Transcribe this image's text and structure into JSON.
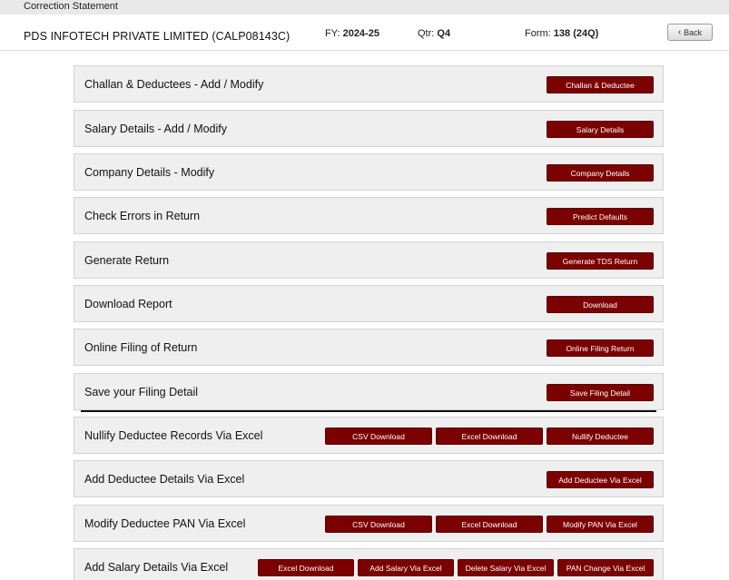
{
  "window": {
    "title": "Correction Statement"
  },
  "header": {
    "company": "PDS INFOTECH PRIVATE LIMITED (CALP08143C)",
    "fy_label": "FY:",
    "fy_value": "2024-25",
    "qtr_label": "Qtr:",
    "qtr_value": "Q4",
    "form_label": "Form:",
    "form_value": "138 (24Q)",
    "back_label": "Back"
  },
  "rows": [
    {
      "label": "Challan & Deductees - Add / Modify",
      "buttons": [
        "Challan & Deductee"
      ]
    },
    {
      "label": "Salary Details - Add / Modify",
      "buttons": [
        "Salary Details"
      ]
    },
    {
      "label": "Company Details - Modify",
      "buttons": [
        "Company Details"
      ]
    },
    {
      "label": "Check Errors in Return",
      "buttons": [
        "Predict Defaults"
      ]
    },
    {
      "label": "Generate Return",
      "buttons": [
        "Generate TDS Return"
      ]
    },
    {
      "label": "Download Report",
      "buttons": [
        "Download"
      ]
    },
    {
      "label": "Online Filing of Return",
      "buttons": [
        "Online Filing Return"
      ]
    },
    {
      "label": "Save your Filing Detail",
      "buttons": [
        "Save Filing Detail"
      ]
    },
    {
      "label": "Nullify Deductee Records Via Excel",
      "buttons": [
        "CSV Download",
        "Excel Download",
        "Nullify Deductee"
      ]
    },
    {
      "label": "Add Deductee Details Via Excel",
      "buttons": [
        "Add Deductee Via Excel"
      ]
    },
    {
      "label": "Modify Deductee PAN Via Excel",
      "buttons": [
        "CSV Download",
        "Excel Download",
        "Modify PAN Via Excel"
      ]
    },
    {
      "label": "Add Salary Details Via Excel",
      "buttons": [
        "Excel Download",
        "Add Salary Via Excel",
        "Delete Salary Via Excel",
        "PAN Change Via Excel"
      ]
    }
  ],
  "colors": {
    "button_bg": "#7b0000",
    "row_bg": "#efefef"
  }
}
